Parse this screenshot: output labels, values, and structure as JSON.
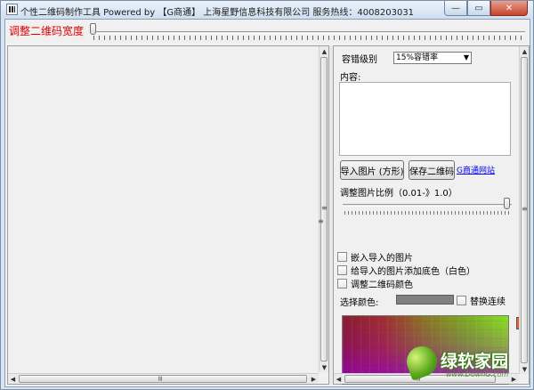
{
  "window": {
    "title": "个性二维码制作工具  Powered by 【G商通】 上海星野信息科技有限公司 服务热线：4008203031",
    "minimize_glyph": "—",
    "restore_glyph": "▭",
    "close_glyph": "✕"
  },
  "top": {
    "width_label": "调整二维码宽度",
    "width_level": 0
  },
  "right": {
    "ec_label": "容错级别",
    "ec_value": "15%容错率",
    "content_label": "内容:",
    "content_value": "",
    "import_button": "导入图片 (方形)",
    "save_button": "保存二维码",
    "site_link": "G商通网站",
    "ratio_label": "调整图片比例（0.01-》1.0）",
    "ratio_level": 1.0,
    "checkboxes": [
      {
        "label": "嵌入导入的图片",
        "checked": false
      },
      {
        "label": "给导入的图片添加底色（白色）",
        "checked": false
      },
      {
        "label": "调整二维码颜色",
        "checked": false
      }
    ],
    "color_label": "选择颜色:",
    "selected_color": "#808080",
    "replace_label": "替换连续",
    "replace_checked": false,
    "hue_color": "#f35b2a"
  },
  "watermark": {
    "text": "绿软家园",
    "url": "www.DownG.com"
  },
  "icons": {
    "arrow_up": "▲",
    "arrow_down": "▼",
    "arrow_left": "◀",
    "arrow_right": "▶",
    "grip": "≡",
    "select_arrow": "▼"
  }
}
